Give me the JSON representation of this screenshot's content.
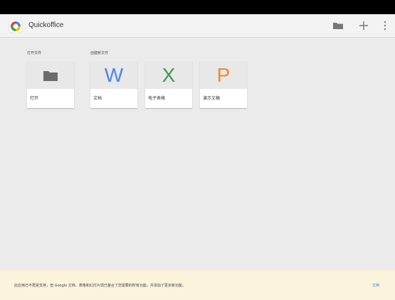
{
  "app": {
    "title": "Quickoffice"
  },
  "toolbar": {
    "folder_icon": "folder-icon",
    "add_icon": "plus-icon",
    "menu_icon": "overflow-menu-icon"
  },
  "sections": {
    "open_label": "打开文件",
    "new_label": "创建新文件"
  },
  "tiles": [
    {
      "label": "打开",
      "icon": "folder-icon",
      "color": "#6b6b6b"
    },
    {
      "label": "文档",
      "letter": "W",
      "color": "#4a86e8"
    },
    {
      "label": "电子表格",
      "letter": "X",
      "color": "#3c9a4f"
    },
    {
      "label": "演示文稿",
      "letter": "P",
      "color": "#ef8a33"
    }
  ],
  "banner": {
    "text": "此应用已不再受支持，但 Google 文档、表格和幻灯片现已整合了您需要的所有功能，并添加了更多新功能。",
    "link_label": "文档"
  },
  "colors": {
    "background": "#ebebeb",
    "app_bar": "#f3f3f3",
    "banner_bg": "#fbf3dc",
    "link": "#3b7fd9"
  }
}
